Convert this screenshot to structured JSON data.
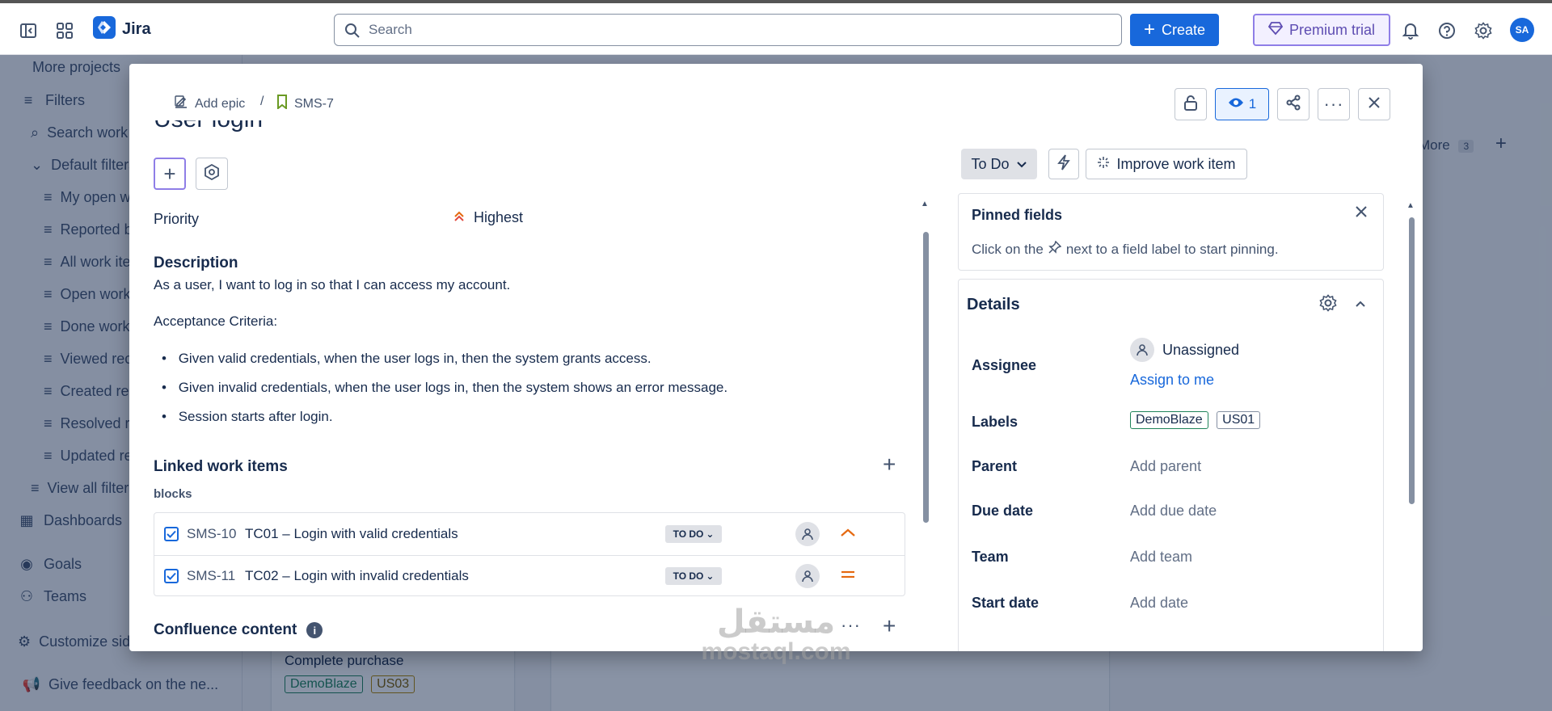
{
  "app": {
    "name": "Jira"
  },
  "topbar": {
    "search_placeholder": "Search",
    "create_label": "Create",
    "premium_label": "Premium trial",
    "avatar_initials": "SA"
  },
  "sidebar": {
    "more_projects": "More projects",
    "filters": "Filters",
    "search_work": "Search work items",
    "default_filters": "Default filters",
    "items": [
      "My open work items",
      "Reported by me",
      "All work items",
      "Open work items",
      "Done work items",
      "Viewed recently",
      "Created recently",
      "Resolved recently",
      "Updated recently"
    ],
    "view_all": "View all filters",
    "dashboards": "Dashboards",
    "goals": "Goals",
    "teams": "Teams",
    "customize": "Customize sidebar",
    "feedback": "Give feedback on the ne..."
  },
  "background": {
    "more_label": "More",
    "more_count": "3",
    "card_title": "Complete purchase",
    "card_tags": [
      "DemoBlaze",
      "US03"
    ]
  },
  "modal": {
    "breadcrumb": {
      "add_epic": "Add epic",
      "separator": "/",
      "key": "SMS-7"
    },
    "watch_count": "1",
    "title": "User login",
    "priority_label": "Priority",
    "priority_value": "Highest",
    "description_label": "Description",
    "description_text": "As a user, I want to log in so that I can access my account.",
    "acceptance_label": "Acceptance Criteria:",
    "criteria": [
      "Given valid credentials, when the user logs in, then the system grants access.",
      "Given invalid credentials, when the user logs in, then the system shows an error message.",
      "Session starts after login."
    ],
    "linked_label": "Linked work items",
    "blocks_label": "blocks",
    "linked_items": [
      {
        "key": "SMS-10",
        "summary": "TC01 – Login with valid credentials",
        "status": "TO DO",
        "priority": "high"
      },
      {
        "key": "SMS-11",
        "summary": "TC02 – Login with invalid credentials",
        "status": "TO DO",
        "priority": "medium"
      }
    ],
    "confluence_label": "Confluence content",
    "status_button": "To Do",
    "improve_button": "Improve work item",
    "pinned": {
      "title": "Pinned fields",
      "hint_before": "Click on the",
      "hint_after": "next to a field label to start pinning."
    },
    "details": {
      "title": "Details",
      "assignee_label": "Assignee",
      "assignee_value": "Unassigned",
      "assign_to_me": "Assign to me",
      "labels_label": "Labels",
      "labels": [
        "DemoBlaze",
        "US01"
      ],
      "parent_label": "Parent",
      "parent_value": "Add parent",
      "due_label": "Due date",
      "due_value": "Add due date",
      "team_label": "Team",
      "team_value": "Add team",
      "start_label": "Start date",
      "start_value": "Add date"
    }
  },
  "watermark": {
    "arabic": "مستقل",
    "latin": "mostaql.com"
  },
  "colors": {
    "accent": "#1868db",
    "premium": "#5e4db2",
    "priority_high": "#e2483d",
    "priority_medium": "#e56910",
    "label_green": "#1f845a"
  }
}
